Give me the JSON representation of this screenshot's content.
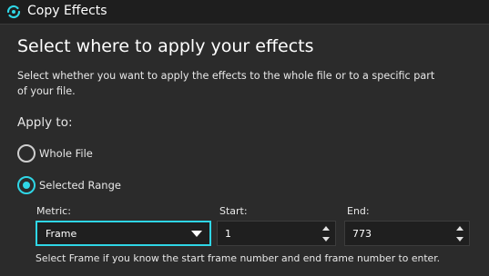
{
  "window": {
    "title": "Copy Effects",
    "icon": "copy-effects-app-icon"
  },
  "dialog": {
    "heading": "Select where to apply your effects",
    "description": "Select whether you want to apply the effects to the whole file or to a specific part of your file.",
    "apply_label": "Apply to:",
    "options": [
      {
        "label": "Whole File",
        "selected": false
      },
      {
        "label": "Selected Range",
        "selected": true
      }
    ],
    "metric": {
      "label": "Metric:",
      "value": "Frame"
    },
    "start": {
      "label": "Start:",
      "value": "1"
    },
    "end": {
      "label": "End:",
      "value": "773"
    },
    "hint": "Select Frame if you know the start frame number and end frame number to enter."
  },
  "colors": {
    "accent": "#2fd6e6",
    "background": "#2b2b2b",
    "titlebar": "#1e1e1e",
    "field": "#1f1f1f"
  }
}
